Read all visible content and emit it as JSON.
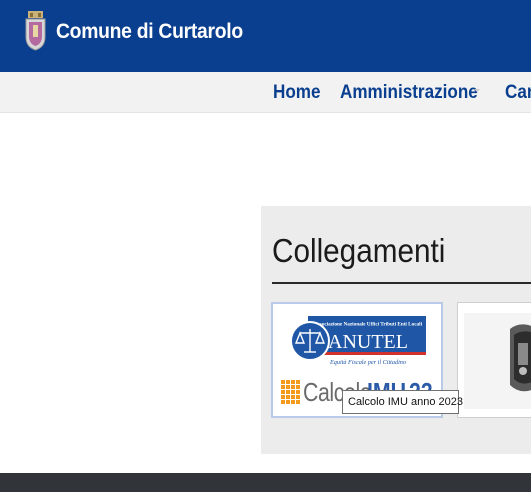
{
  "header": {
    "site_title": "Comune di Curtarolo",
    "crest_icon": "coat-of-arms-icon",
    "background_color": "#0a3f8f"
  },
  "nav": {
    "items": [
      {
        "label": "Home"
      },
      {
        "label": "Amministrazione"
      },
      {
        "label": "Can"
      }
    ]
  },
  "collegamenti": {
    "title": "Collegamenti",
    "cards": [
      {
        "logo_text": "ANUTEL",
        "logo_banner": "Associazione Nazionale Uffici Tributi Enti Locali",
        "logo_tagline": "Equità Fiscale per il Cittadino",
        "calcolo_word": "Calcolo",
        "calcolo_imu": "IMU",
        "calcolo_year": "23"
      },
      {
        "icon": "municipal-seal-icon"
      }
    ]
  },
  "tooltip": {
    "text": "Calcolo IMU anno 2023"
  }
}
